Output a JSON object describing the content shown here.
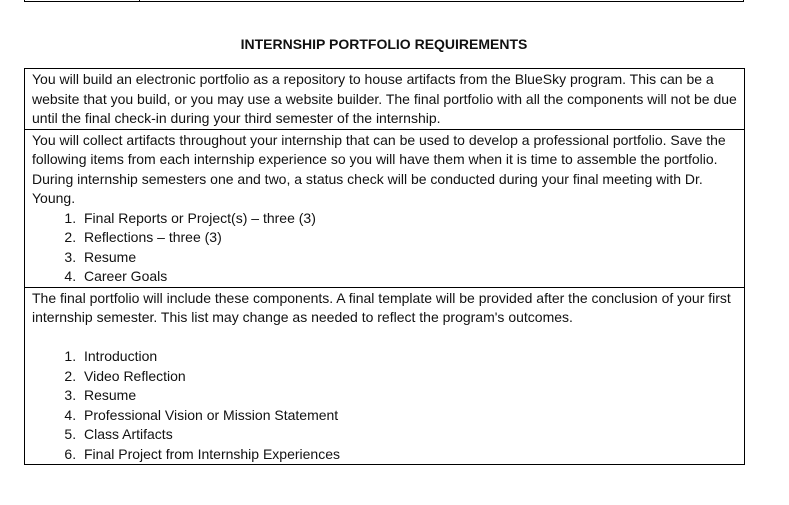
{
  "document": {
    "title": "INTERNSHIP PORTFOLIO REQUIREMENTS",
    "rows": [
      {
        "text": "You will build an electronic portfolio as a repository to house artifacts from the BlueSky program. This can be a website that you build, or you may use a website builder. The final portfolio with all the components will not be due until the final check-in during your third semester of the internship."
      },
      {
        "text": "You will collect artifacts throughout your internship that can be used to develop a professional portfolio. Save the following items from each internship experience so you will have them when it is time to assemble the portfolio. During internship semesters one and two, a status check will be conducted during your final meeting with Dr. Young.",
        "items": [
          "Final Reports or Project(s) – three (3)",
          "Reflections – three (3)",
          "Resume",
          "Career Goals"
        ]
      },
      {
        "text": "The final portfolio will include these components. A final template will be provided after the conclusion of your first internship semester. This list may change as needed to reflect the program's outcomes.",
        "items": [
          "Introduction",
          "Video Reflection",
          "Resume",
          "Professional Vision or Mission Statement",
          "Class Artifacts",
          "Final Project from Internship Experiences"
        ]
      }
    ]
  }
}
